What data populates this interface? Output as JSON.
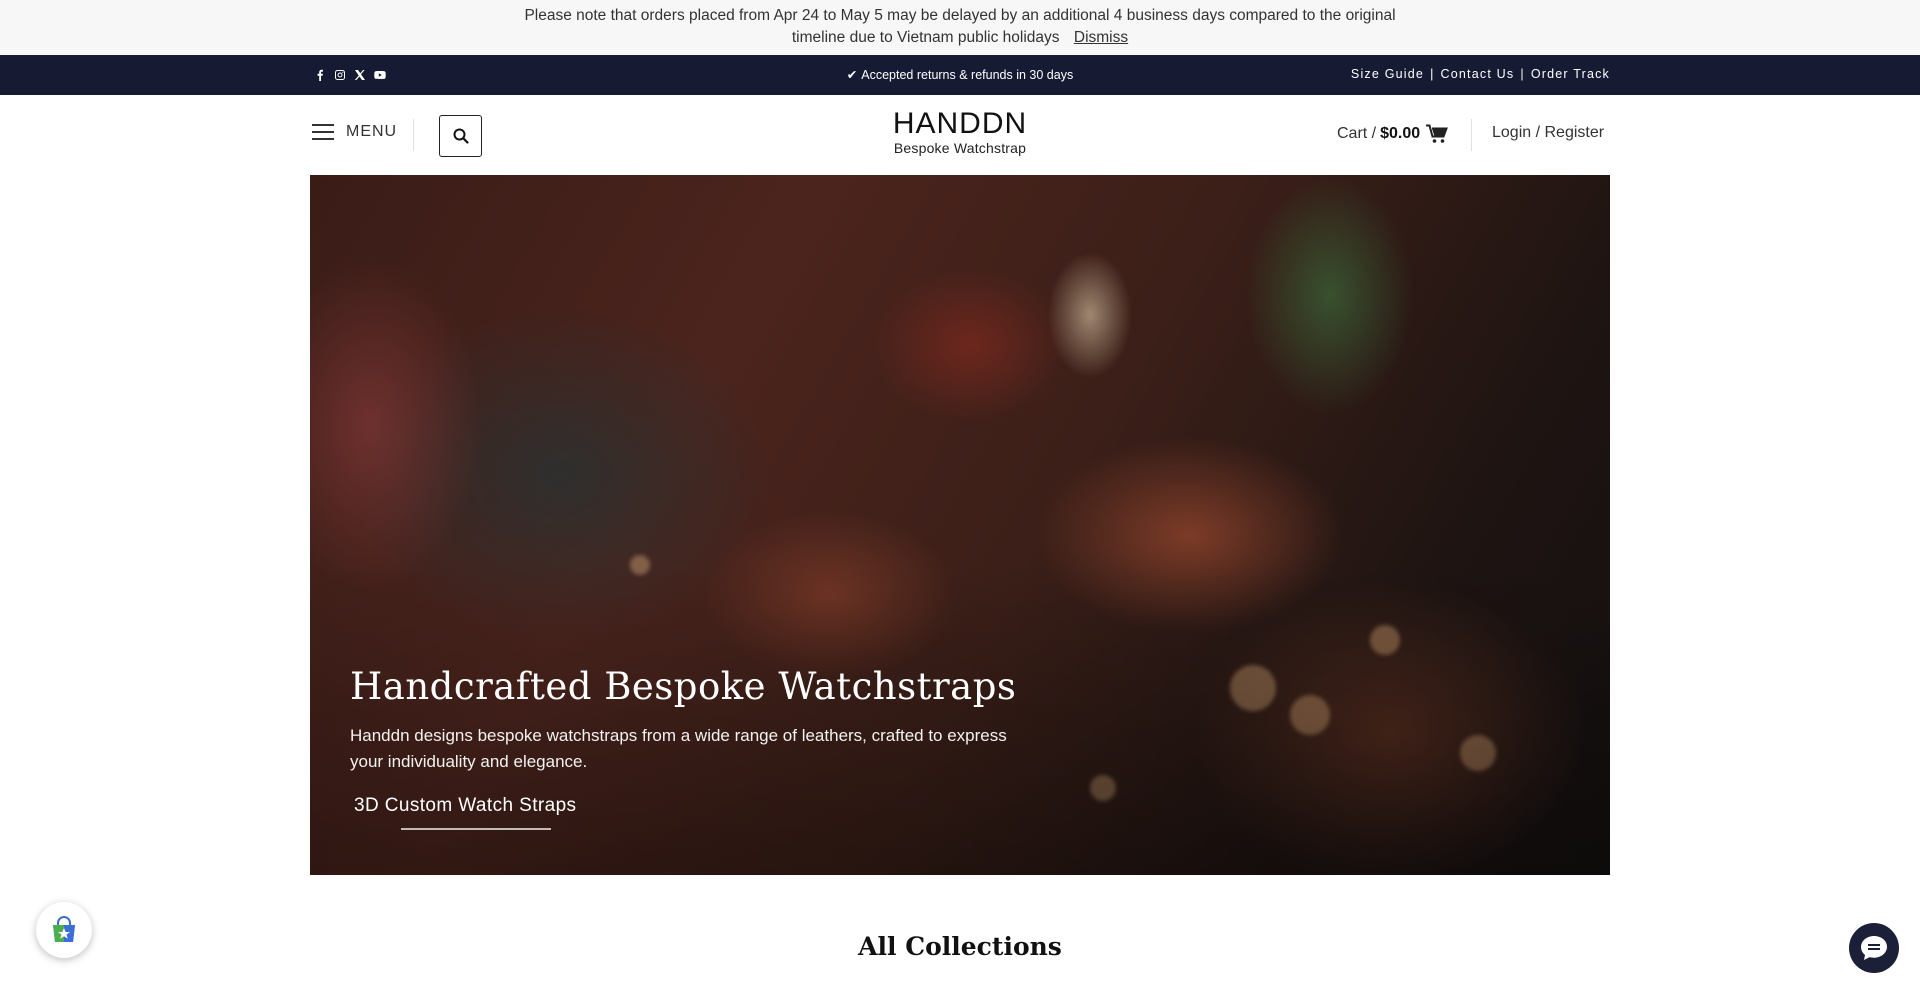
{
  "notice": {
    "line1": "Please note that orders placed from Apr 24 to May 5 may be delayed by an additional 4 business days compared to the original",
    "line2": "timeline due to Vietnam public holidays",
    "dismiss_label": "Dismiss"
  },
  "topbar": {
    "social_icons": [
      "facebook-icon",
      "instagram-icon",
      "x-icon",
      "youtube-icon"
    ],
    "promo_text": "Accepted returns & refunds in 30 days",
    "links": [
      "Size Guide",
      "Contact Us",
      "Order Track"
    ],
    "separator": "|"
  },
  "header": {
    "menu_label": "MENU",
    "logo_brand": "HANDDN",
    "logo_tagline": "Bespoke Watchstrap",
    "cart_label": "Cart /",
    "cart_total": "$0.00",
    "login_label": "Login / Register"
  },
  "hero": {
    "title": "Handcrafted Bespoke Watchstraps",
    "description": "Handdn designs bespoke watchstraps from a wide range of leathers, crafted to express your individuality and elegance.",
    "cta_label": "3D Custom Watch Straps"
  },
  "collections": {
    "heading": "All Collections"
  },
  "colors": {
    "topbar_bg": "#161b33",
    "notice_bg": "#f7f7f8",
    "chat_bg": "#1b2038"
  }
}
